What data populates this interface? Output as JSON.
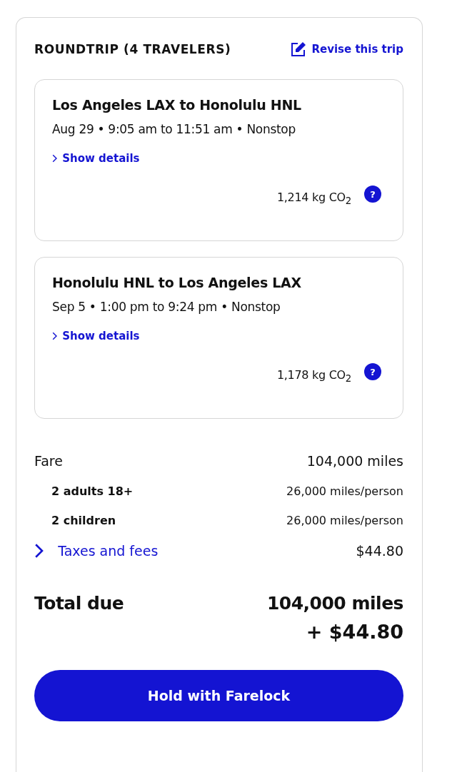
{
  "header": {
    "title": "ROUNDTRIP (4 TRAVELERS)",
    "revise_link": "Revise this trip"
  },
  "flights": [
    {
      "route": "Los Angeles LAX to Honolulu HNL",
      "schedule": "Aug 29 • 9:05 am to 11:51 am • Nonstop",
      "details_link": "Show details",
      "emissions": "1,214 kg CO$_{2}$",
      "help": "?"
    },
    {
      "route": "Honolulu HNL to Los Angeles LAX",
      "schedule": "Sep 5 • 1:00 pm to 9:24 pm • Nonstop",
      "details_link": "Show details",
      "emissions": "1,178 kg CO$_{2}$",
      "help": "?"
    }
  ],
  "price_rows": [
    {
      "kind": "main",
      "label": "Fare",
      "value": "104,000 miles"
    },
    {
      "kind": "sub",
      "label": "2 adults 18+",
      "value": "26,000 miles/person"
    },
    {
      "kind": "sub",
      "label": "2 children",
      "value": "26,000 miles/person"
    },
    {
      "kind": "link",
      "label": "Taxes and fees",
      "value": "$44.80"
    }
  ],
  "total": {
    "label": "Total due",
    "miles": "104,000 miles",
    "cash": "+ $44.80"
  },
  "hold_button": "Hold with Farelock"
}
